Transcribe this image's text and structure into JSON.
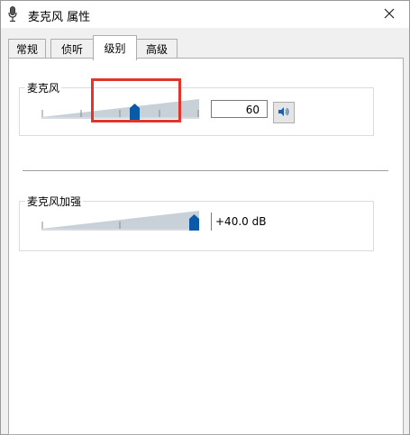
{
  "window": {
    "title": "麦克风 属性"
  },
  "tabs": [
    {
      "label": "常规",
      "active": false
    },
    {
      "label": "侦听",
      "active": false
    },
    {
      "label": "级别",
      "active": true
    },
    {
      "label": "高级",
      "active": false
    }
  ],
  "microphone": {
    "label": "麦克风",
    "value": "60",
    "level": 0.6
  },
  "boost": {
    "label": "麦克风加强",
    "value": "+40.0 dB",
    "level": 1.0
  },
  "icons": {
    "title": "microphone-icon",
    "close": "close-icon",
    "mute": "speaker-icon"
  },
  "colors": {
    "thumb": "#0a5aa8",
    "track": "#c8d0d8",
    "highlight": "#e0352b"
  }
}
